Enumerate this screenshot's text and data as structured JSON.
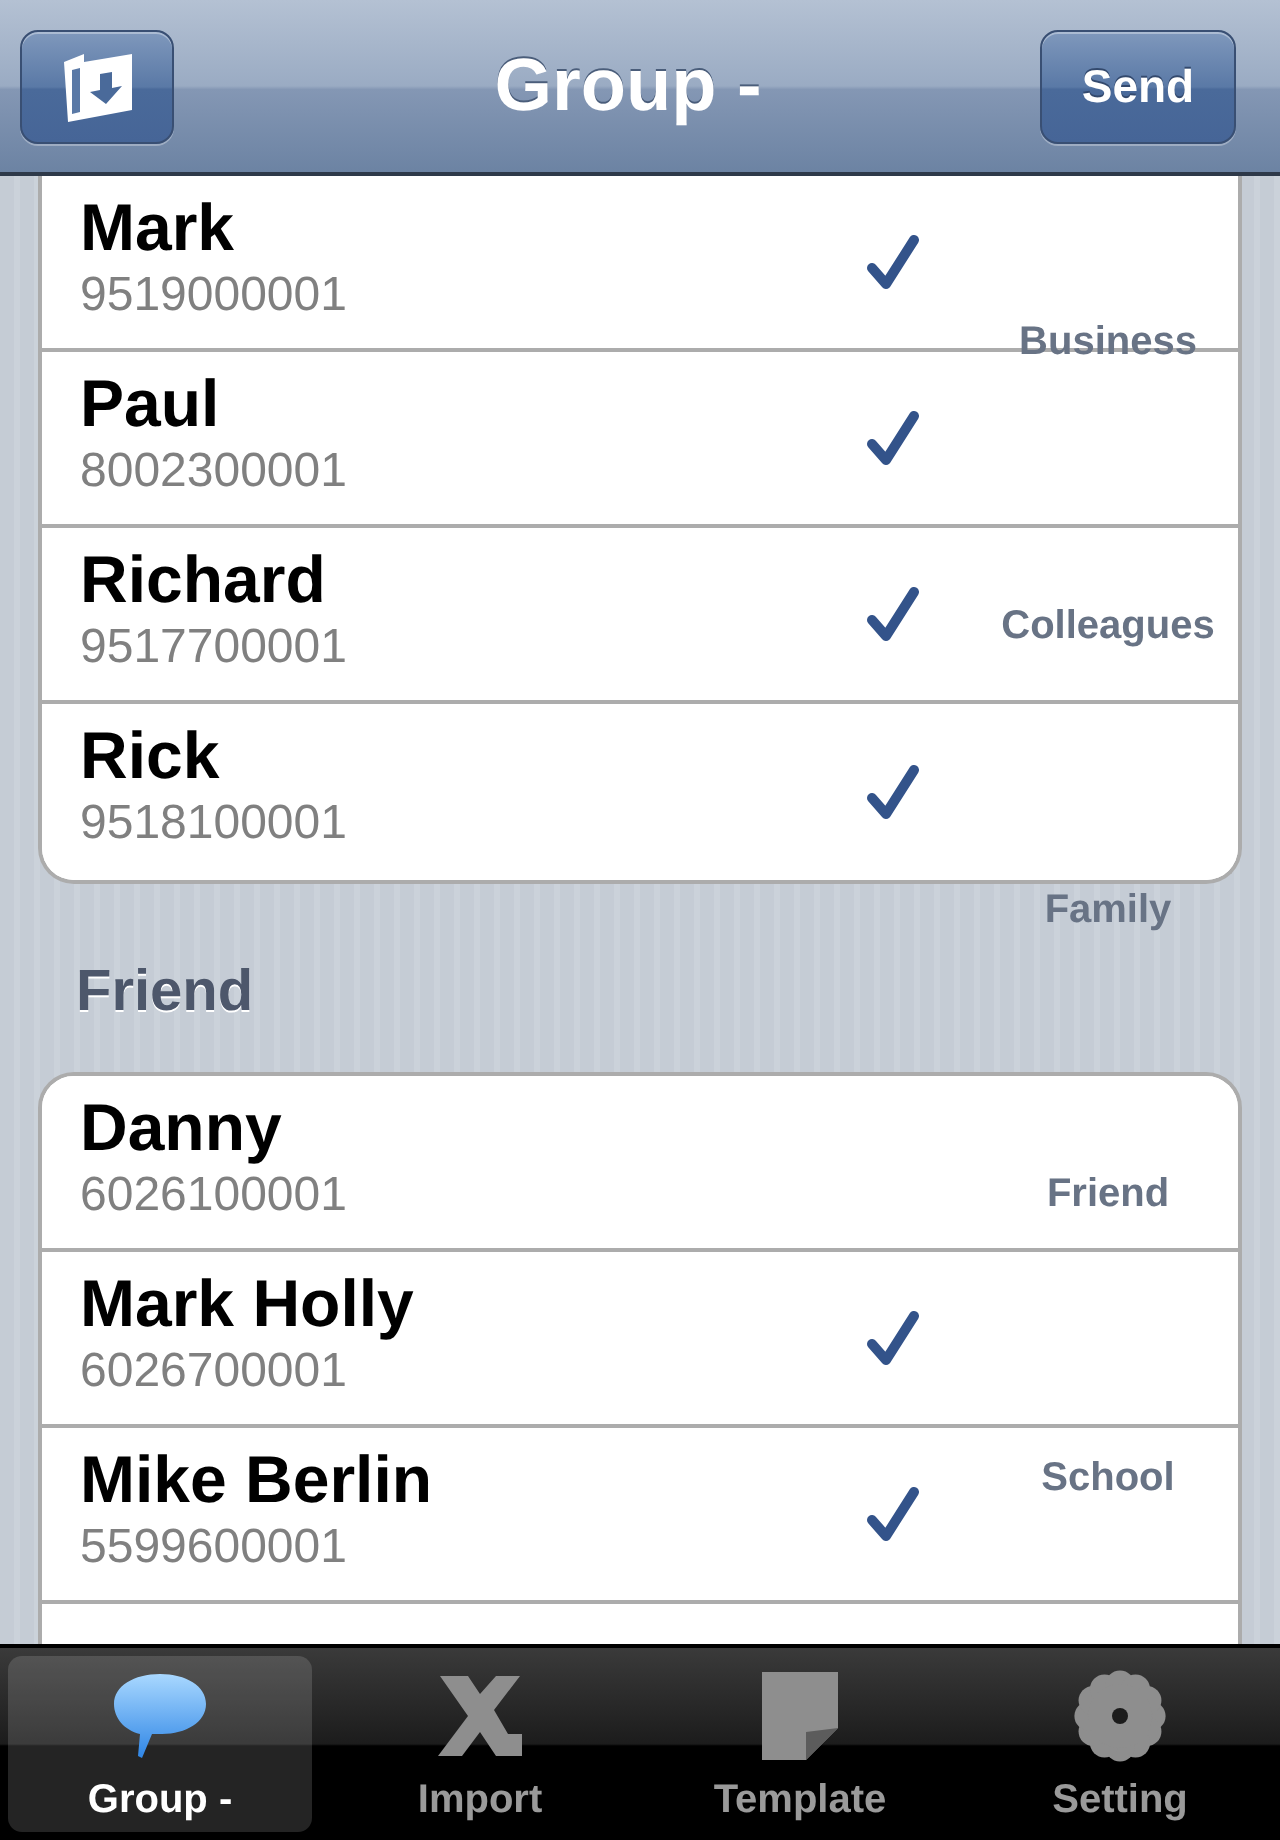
{
  "nav_bar": {
    "title": "Group -",
    "send_button": "Send"
  },
  "sections": [
    {
      "rows": [
        {
          "name": "Mark",
          "number": "9519000001",
          "checked": true
        },
        {
          "name": "Paul",
          "number": "8002300001",
          "checked": true
        },
        {
          "name": "Richard",
          "number": "9517700001",
          "checked": true
        },
        {
          "name": "Rick",
          "number": "9518100001",
          "checked": true
        }
      ]
    },
    {
      "header": "Friend",
      "rows": [
        {
          "name": "Danny",
          "number": "6026100001",
          "checked": false
        },
        {
          "name": "Mark Holly",
          "number": "6026700001",
          "checked": true
        },
        {
          "name": "Mike Berlin",
          "number": "5599600001",
          "checked": true
        },
        {}
      ]
    }
  ],
  "section_index": [
    "Business",
    "Colleagues",
    "Family",
    "Friend",
    "School"
  ],
  "tab_bar": [
    {
      "label": "Group -",
      "selected": true
    },
    {
      "label": "Import",
      "selected": false
    },
    {
      "label": "Template",
      "selected": false
    },
    {
      "label": "Setting",
      "selected": false
    }
  ]
}
